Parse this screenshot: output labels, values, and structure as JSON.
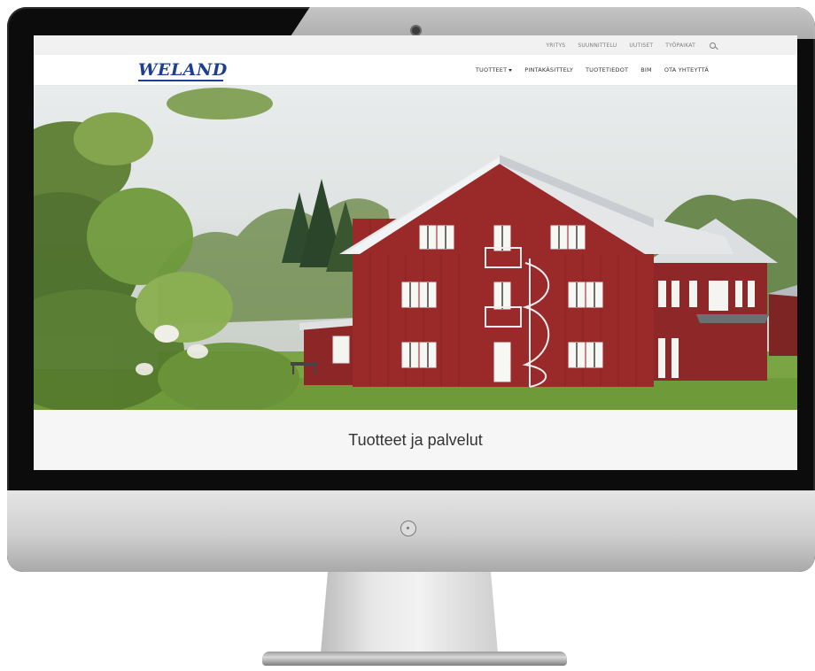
{
  "topbar": {
    "links": [
      "YRITYS",
      "SUUNNITTELU",
      "UUTISET",
      "TYÖPAIKAT"
    ]
  },
  "logo": {
    "text": "WELAND",
    "color": "#1e3f8f"
  },
  "mainnav": {
    "products": "TUOTTEET",
    "items": [
      "PINTAKÄSITTELY",
      "TUOTETIEDOT",
      "BIM",
      "OTA YHTEYTTÄ"
    ]
  },
  "hero": {
    "building_color": "#9a2a2a",
    "roof_color": "#e4e6e8",
    "lawn_color": "#6f9a3a"
  },
  "section": {
    "title": "Tuotteet ja palvelut"
  },
  "icons": {
    "search": "search-icon",
    "camera": "camera-icon",
    "power": "power-button-icon",
    "dropdown": "caret-down-icon"
  }
}
